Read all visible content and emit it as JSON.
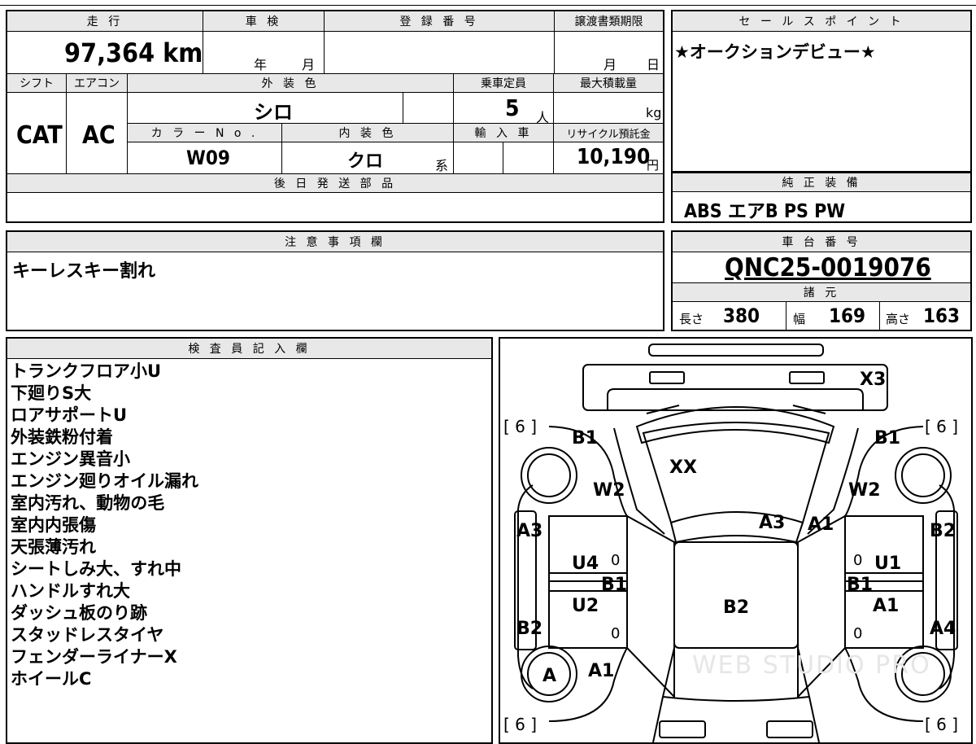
{
  "vehicle": {
    "mileage_label": "走 行",
    "mileage": "97,364 km",
    "inspection_label": "車 検",
    "inspection_year_unit": "年",
    "inspection_month_unit": "月",
    "registration_label": "登 録 番 号",
    "transfer_label": "譲渡書類期限",
    "transfer_month_unit": "月",
    "transfer_day_unit": "日",
    "shift_label": "シフト",
    "shift": "CAT",
    "ac_label": "エアコン",
    "ac": "AC",
    "exterior_label": "外 装 色",
    "exterior": "シロ",
    "capacity_label": "乗車定員",
    "capacity": "5",
    "capacity_unit": "人",
    "max_load_label": "最大積載量",
    "max_load_unit": "kg",
    "color_no_label": "カ ラ ー N o .",
    "color_no": "W09",
    "interior_label": "内 装 色",
    "interior": "クロ",
    "interior_unit": "系",
    "import_label": "輸 入 車",
    "recycle_label": "リサイクル預託金",
    "recycle": "10,190",
    "recycle_unit": "円",
    "later_parts_label": "後 日 発 送 部 品"
  },
  "sales": {
    "label": "セ ー ル ス ポ イ ン ト",
    "text": "★オークションデビュー★"
  },
  "equipment": {
    "label": "純 正 装 備",
    "text": "ABS エアB PS PW"
  },
  "caution": {
    "label": "注 意 事 項 欄",
    "text": "キーレスキー割れ"
  },
  "chassis": {
    "label": "車 台 番 号",
    "number": "QNC25-0019076",
    "specs_label": "諸 元",
    "length_label": "長さ",
    "length": "380",
    "width_label": "幅",
    "width": "169",
    "height_label": "高さ",
    "height": "163"
  },
  "inspector": {
    "label": "検 査 員 記 入 欄",
    "notes": [
      "トランクフロア小U",
      "下廻りS大",
      "ロアサポートU",
      "外装鉄粉付着",
      "エンジン異音小",
      "エンジン廻りオイル漏れ",
      "室内汚れ、動物の毛",
      "室内内張傷",
      "天張薄汚れ",
      "シートしみ大、すれ中",
      "ハンドルすれ大",
      "ダッシュ板のり跡",
      "スタッドレスタイヤ",
      "フェンダーライナーX",
      "ホイールC"
    ]
  },
  "diagram": {
    "tire_tl": "[ 6 ]",
    "tire_tr": "[ 6 ]",
    "tire_bl": "[ 6 ]",
    "tire_br": "[ 6 ]",
    "x3": "X3",
    "b1_fl": "B1",
    "b1_fr": "B1",
    "xx": "XX",
    "w2_l": "W2",
    "w2_r": "W2",
    "a3_l": "A3",
    "a3_c": "A3",
    "a1_fr": "A1",
    "b2_r": "B2",
    "u4": "U4",
    "u1": "U1",
    "zero_1": "0",
    "zero_2": "0",
    "zero_3": "0",
    "zero_4": "0",
    "b1_ml": "B1",
    "b1_mr": "B1",
    "u2": "U2",
    "b2_c": "B2",
    "a1_r": "A1",
    "b2_l": "B2",
    "a4": "A4",
    "a_tire": "A",
    "a1_bl": "A1",
    "watermark": "WEB STUDIO PRO"
  }
}
